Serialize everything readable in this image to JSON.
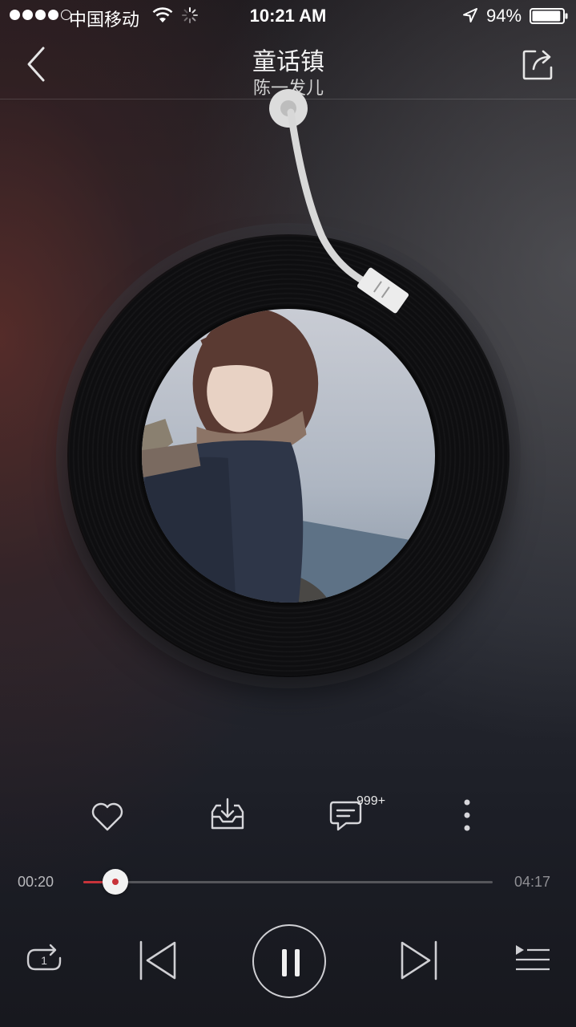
{
  "status_bar": {
    "carrier": "中国移动",
    "time": "10:21 AM",
    "battery_percent": "94%",
    "battery_level": 0.94,
    "signal_bars_filled": 4,
    "signal_bars_total": 5
  },
  "header": {
    "song_title": "童话镇",
    "artist": "陈一发儿"
  },
  "actions": {
    "comment_count": "999+"
  },
  "progress": {
    "current_time": "00:20",
    "total_time": "04:17",
    "fraction": 0.078
  },
  "icons": {
    "back": "chevron-left-icon",
    "share": "share-icon",
    "like": "heart-icon",
    "download": "download-icon",
    "comment": "comment-icon",
    "more": "more-vertical-icon",
    "repeat": "repeat-one-icon",
    "previous": "skip-previous-icon",
    "pause": "pause-icon",
    "next": "skip-next-icon",
    "playlist": "playlist-icon"
  },
  "colors": {
    "accent": "#c8333a",
    "track": "#55565b",
    "thumb": "#f2f2f2"
  }
}
